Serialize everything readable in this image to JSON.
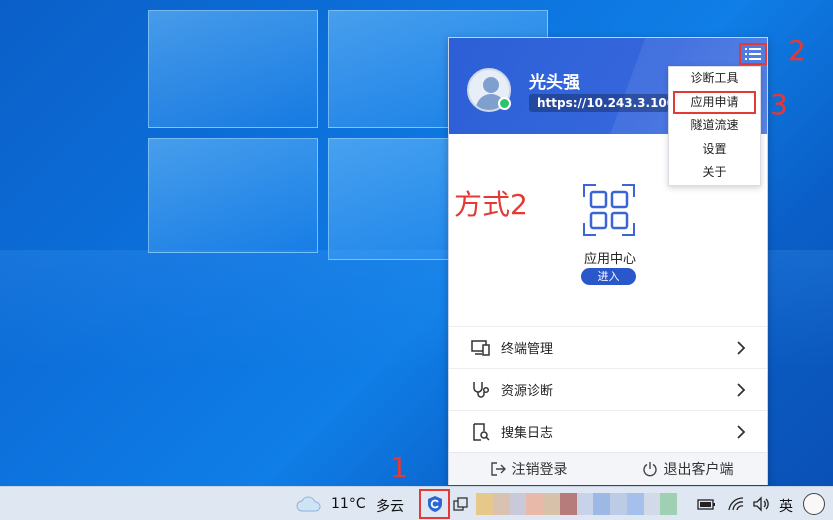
{
  "client": {
    "username": "光头强",
    "server_url": "https://10.243.3.100",
    "menu": {
      "items": [
        "诊断工具",
        "应用申请",
        "隧道流速",
        "设置",
        "关于"
      ],
      "highlighted_index": 1
    },
    "annotation_way": "方式2",
    "app_center": {
      "label": "应用中心",
      "enter_label": "进入"
    },
    "rows": [
      {
        "label": "终端管理",
        "icon": "monitor-icon"
      },
      {
        "label": "资源诊断",
        "icon": "stethoscope-icon"
      },
      {
        "label": "搜集日志",
        "icon": "log-search-icon"
      }
    ],
    "footer": {
      "logout_label": "注销登录",
      "exit_label": "退出客户端"
    }
  },
  "annotations": {
    "step1": "1",
    "step2": "2",
    "step3": "3"
  },
  "taskbar": {
    "temperature": "11°C",
    "condition": "多云",
    "language": "英"
  },
  "colors": {
    "accent": "#2c5fd6",
    "annotation_red": "#e53935",
    "online": "#2cc36b"
  }
}
